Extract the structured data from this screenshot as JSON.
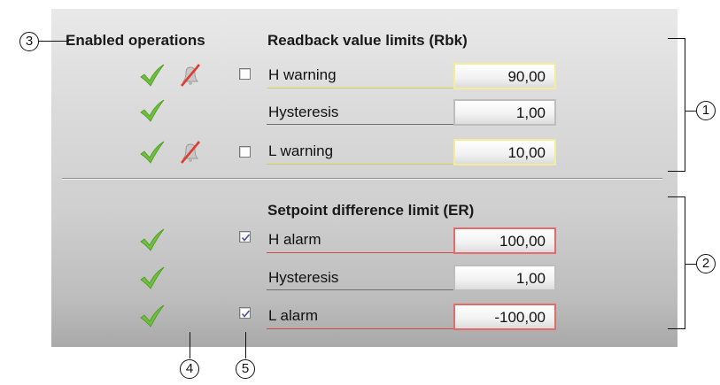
{
  "headers": {
    "enabled_operations": "Enabled operations",
    "readback_limits": "Readback value limits (Rbk)",
    "setpoint_limit": "Setpoint difference limit (ER)"
  },
  "readback_rows": [
    {
      "label": "H warning",
      "value": "90,00",
      "checked": false,
      "border": "yellow"
    },
    {
      "label": "Hysteresis",
      "value": "1,00",
      "border": "grey"
    },
    {
      "label": "L warning",
      "value": "10,00",
      "checked": false,
      "border": "yellow"
    }
  ],
  "setpoint_rows": [
    {
      "label": "H alarm",
      "value": "100,00",
      "checked": true,
      "border": "red"
    },
    {
      "label": "Hysteresis",
      "value": "1,00",
      "border": "grey"
    },
    {
      "label": "L alarm",
      "value": "-100,00",
      "checked": true,
      "border": "red"
    }
  ],
  "callouts": {
    "c1": "1",
    "c2": "2",
    "c3": "3",
    "c4": "4",
    "c5": "5"
  },
  "icons": {
    "enabled": "checkmark-icon",
    "alarm_disabled": "bell-crossed-icon"
  },
  "colors": {
    "check_green": "#6fbf3a",
    "warning_border": "#f4ec9a",
    "alarm_border": "#e56a6a",
    "bell_strike": "#e03c2c"
  }
}
